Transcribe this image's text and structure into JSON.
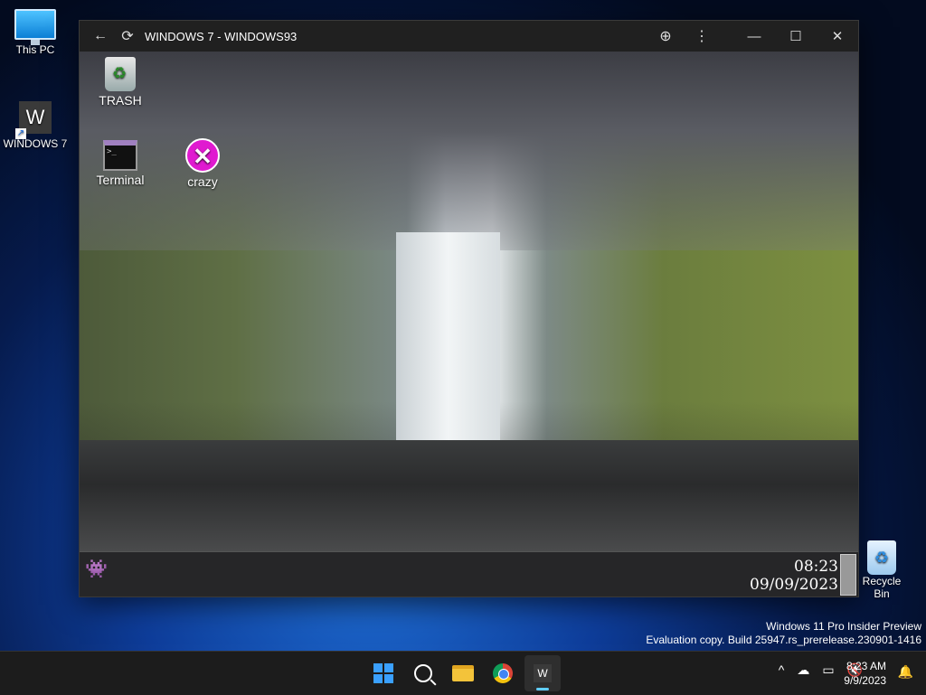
{
  "desktop": {
    "this_pc_label": "This PC",
    "windows7_label": "WINDOWS 7",
    "windows7_tile": "W",
    "recycle_bin_label": "Recycle Bin"
  },
  "app_window": {
    "title": "WINDOWS 7 - WINDOWS93",
    "back_icon": "arrow-left-icon",
    "reload_icon": "refresh-icon",
    "zoom_icon": "zoom-in-icon",
    "menu_icon": "more-vertical-icon",
    "minimize_glyph": "—",
    "maximize_glyph": "☐",
    "close_glyph": "✕"
  },
  "virtual_desktop": {
    "icons": [
      {
        "label": "TRASH"
      },
      {
        "label": "Terminal"
      },
      {
        "label": "crazy"
      }
    ],
    "clock_time": "08:23",
    "clock_date": "09/09/2023"
  },
  "watermark": {
    "line1": "Windows 11 Pro Insider Preview",
    "line2": "Evaluation copy. Build 25947.rs_prerelease.230901-1416"
  },
  "taskbar": {
    "apps": [
      "start",
      "search",
      "file-explorer",
      "chrome",
      "windows93"
    ],
    "active_app_letter": "W",
    "tray_chevron": "^",
    "clock_time": "8:23 AM",
    "clock_date": "9/9/2023"
  },
  "colors": {
    "accent": "#60cdff",
    "start_blue": "#3aa0ff",
    "crazy_magenta": "#e01ad0"
  }
}
